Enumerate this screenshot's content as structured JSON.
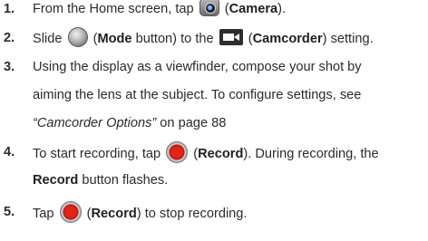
{
  "steps": [
    {
      "number": "1.",
      "before": "From the Home screen, tap ",
      "icon": "camera-icon",
      "paren_open": " (",
      "bold": "Camera",
      "paren_close": ")."
    },
    {
      "number": "2.",
      "before": "Slide ",
      "icon": "mode-button-icon",
      "paren_open": " (",
      "bold": "Mode",
      "mid": " button) to the ",
      "icon2": "camcorder-icon",
      "paren_open2": " (",
      "bold2": "Camcorder",
      "after": ") setting."
    },
    {
      "number": "3.",
      "line1": "Using the display as a viewfinder, compose your shot by",
      "line2": "aiming the lens at the subject. To configure settings, see",
      "italic": "“Camcorder Options”",
      "line3_after": " on page 88"
    },
    {
      "number": "4.",
      "before": "To start recording, tap ",
      "icon": "record-icon",
      "paren_open": " (",
      "bold": "Record",
      "after": "). During recording, the",
      "line2_bold": "Record",
      "line2_after": " button flashes."
    },
    {
      "number": "5.",
      "before": "Tap ",
      "icon": "record-icon",
      "paren_open": " (",
      "bold": "Record",
      "after": ") to stop recording."
    }
  ]
}
